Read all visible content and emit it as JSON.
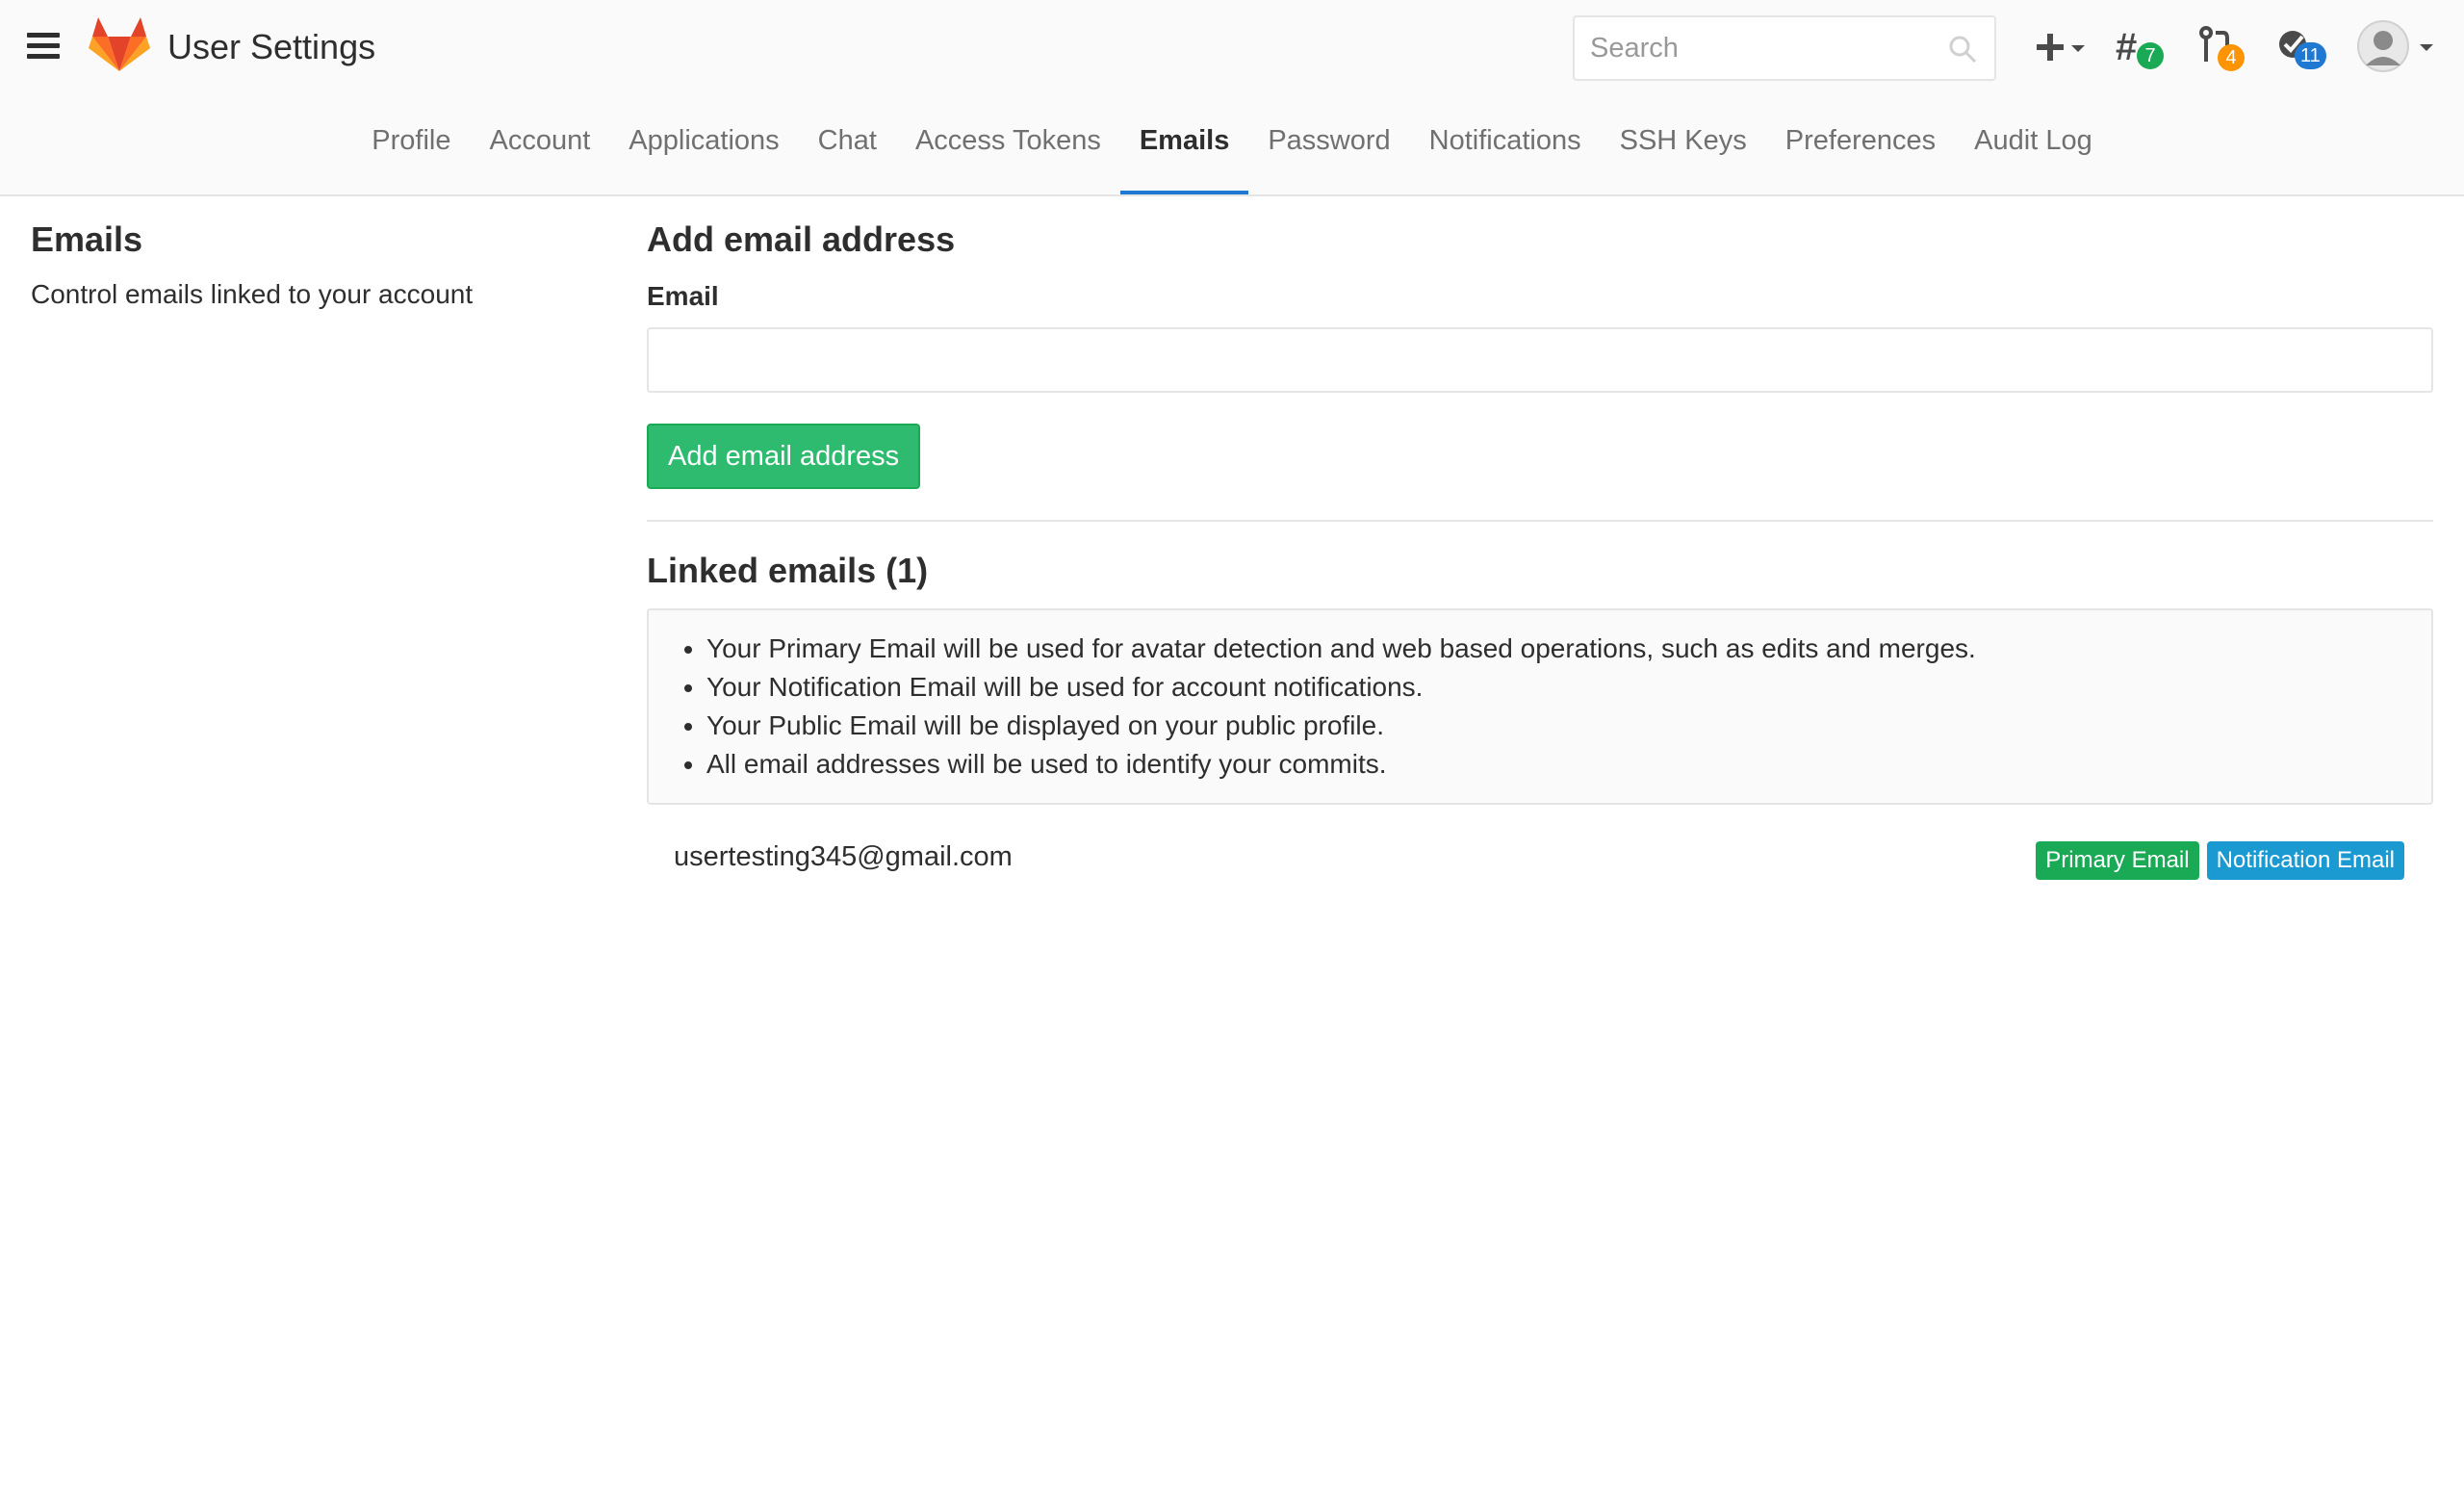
{
  "header": {
    "title": "User Settings",
    "search_placeholder": "Search",
    "badges": {
      "issues": "7",
      "merge_requests": "4",
      "todos": "11"
    }
  },
  "tabs": [
    {
      "label": "Profile"
    },
    {
      "label": "Account"
    },
    {
      "label": "Applications"
    },
    {
      "label": "Chat"
    },
    {
      "label": "Access Tokens"
    },
    {
      "label": "Emails",
      "active": true
    },
    {
      "label": "Password"
    },
    {
      "label": "Notifications"
    },
    {
      "label": "SSH Keys"
    },
    {
      "label": "Preferences"
    },
    {
      "label": "Audit Log"
    }
  ],
  "sidebar": {
    "title": "Emails",
    "description": "Control emails linked to your account"
  },
  "add_form": {
    "title": "Add email address",
    "email_label": "Email",
    "email_value": "",
    "submit_label": "Add email address"
  },
  "linked": {
    "title": "Linked emails (1)",
    "notes": [
      "Your Primary Email will be used for avatar detection and web based operations, such as edits and merges.",
      "Your Notification Email will be used for account notifications.",
      "Your Public Email will be displayed on your public profile.",
      "All email addresses will be used to identify your commits."
    ],
    "emails": [
      {
        "address": "usertesting345@gmail.com",
        "primary_label": "Primary Email",
        "notification_label": "Notification Email"
      }
    ]
  },
  "icons": {
    "menu": "hamburger-icon",
    "logo": "gitlab-tanuki-logo",
    "search": "search-icon",
    "new": "plus-icon",
    "issues": "issues-hash-icon",
    "merge_requests": "merge-request-icon",
    "todos": "todo-check-icon",
    "user": "user-avatar"
  },
  "colors": {
    "accent": "#1f78d1",
    "success": "#1aaa55",
    "info": "#1b9ad2",
    "badge_issues": "#1aaa55",
    "badge_mr": "#fc9403",
    "badge_todos": "#1f78d1"
  }
}
